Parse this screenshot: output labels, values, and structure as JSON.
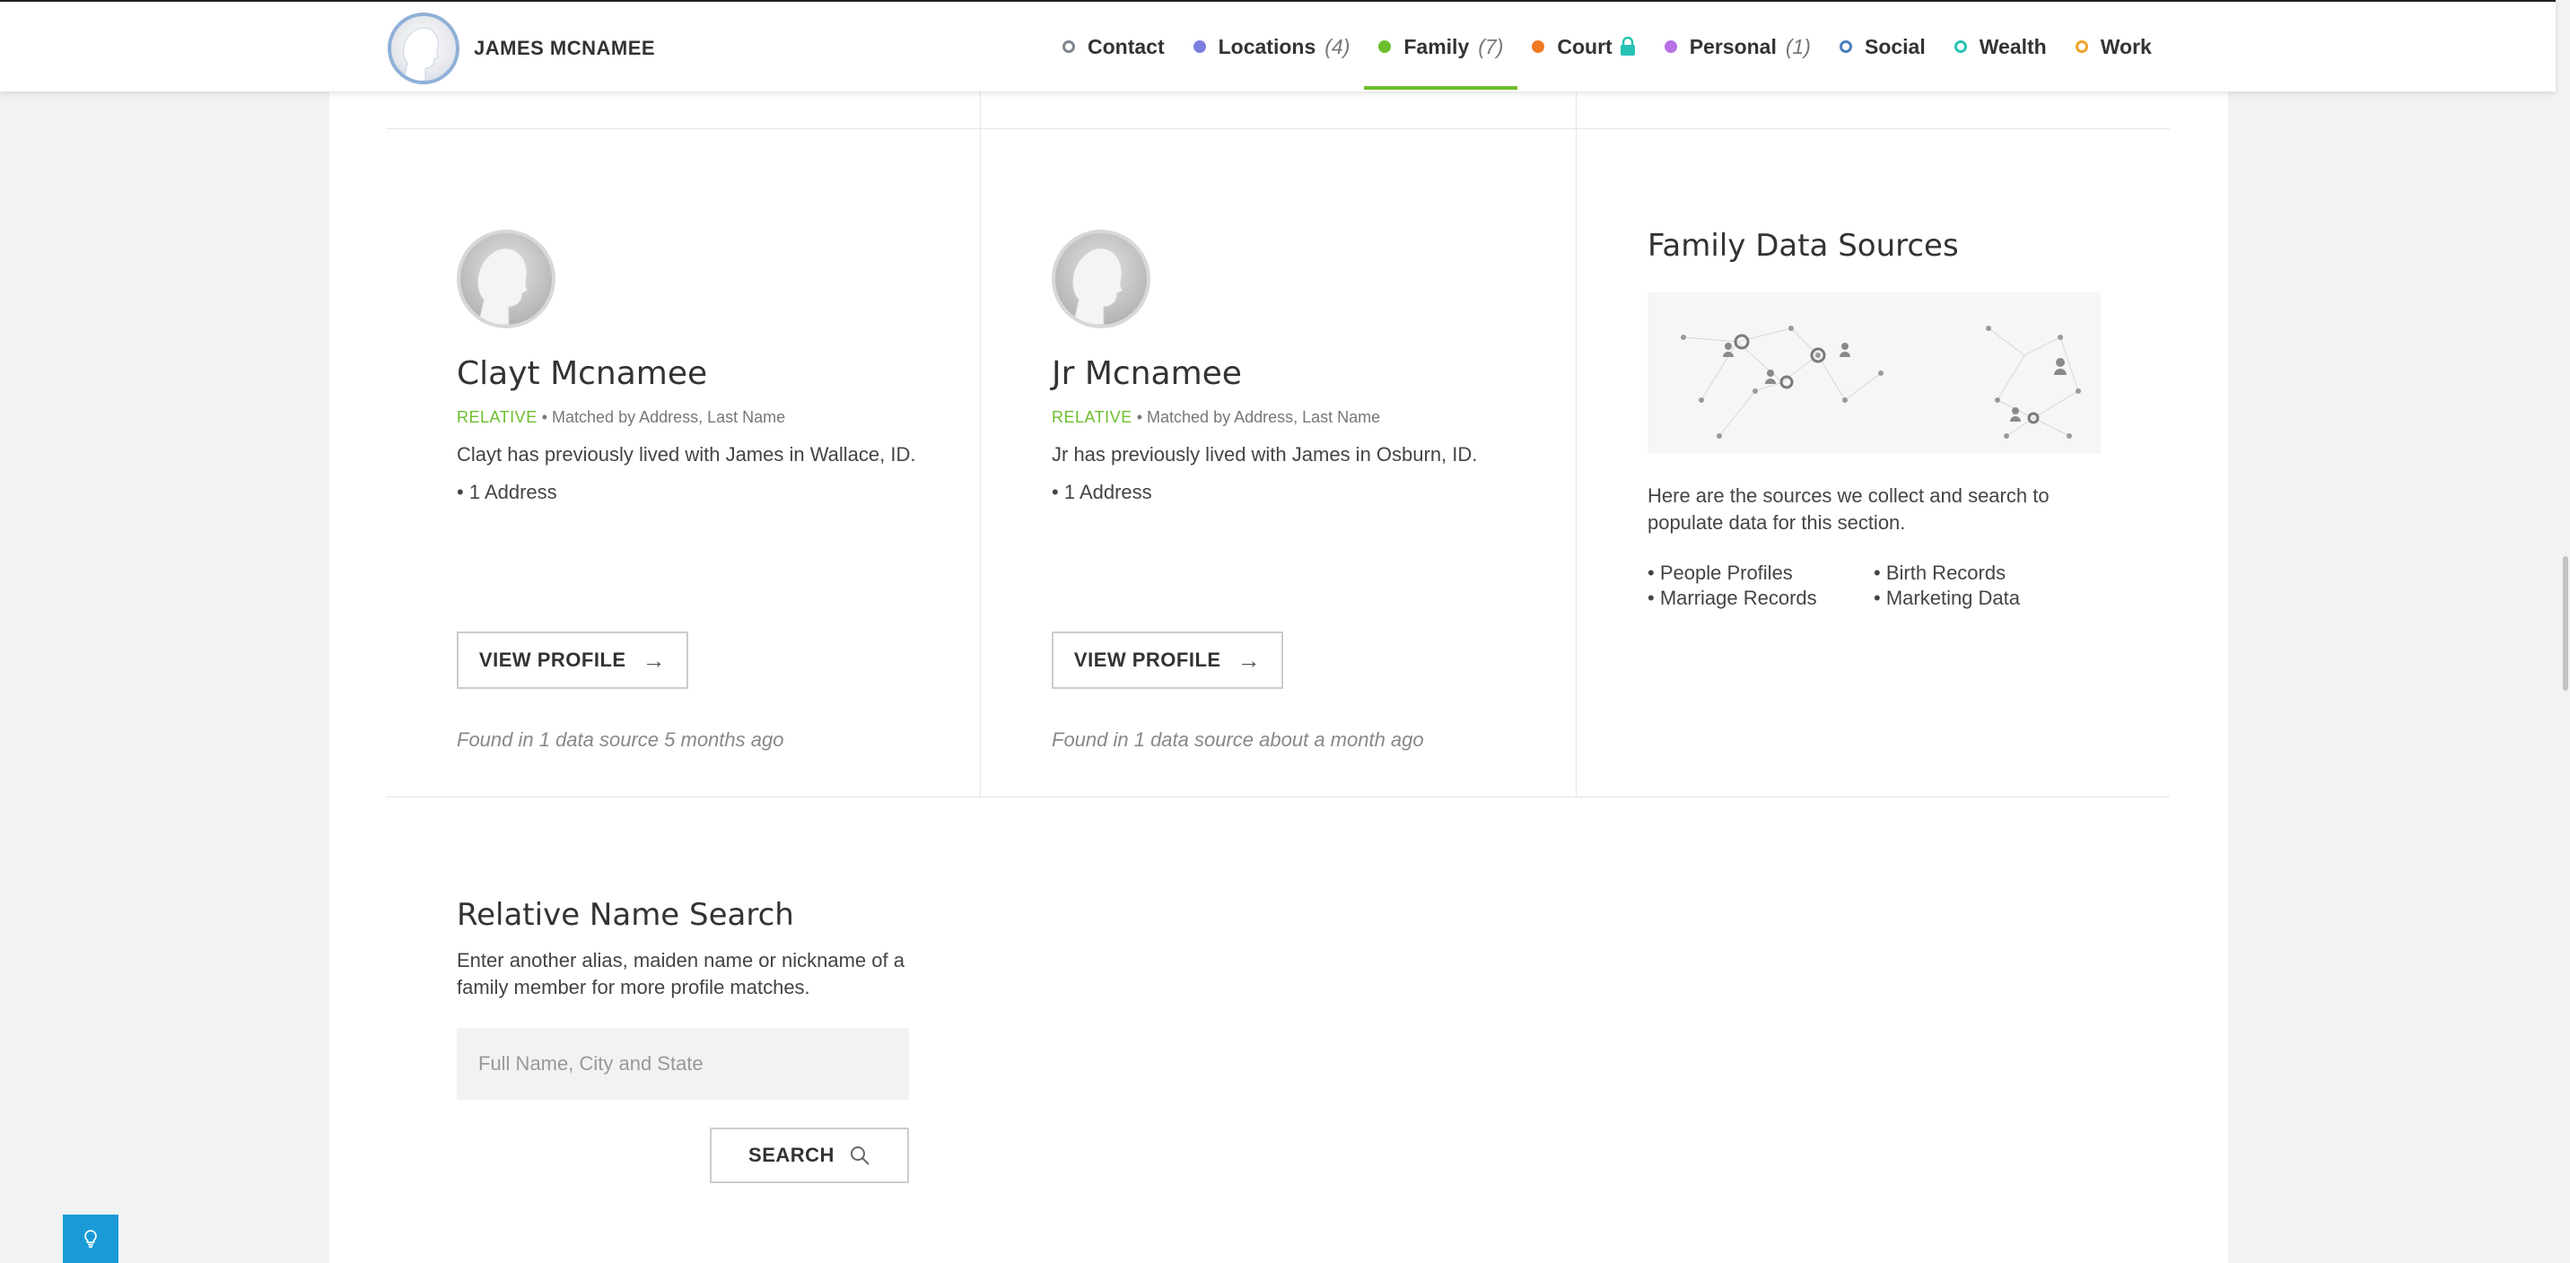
{
  "header": {
    "name": "JAMES MCNAMEE",
    "nav": [
      {
        "label": "Contact",
        "count": "",
        "color": "#7d8590",
        "style": "ring",
        "active": false
      },
      {
        "label": "Locations",
        "count": "(4)",
        "color": "#7b7fe0",
        "style": "fill",
        "active": false
      },
      {
        "label": "Family",
        "count": "(7)",
        "color": "#6cbe2c",
        "style": "fill",
        "active": true
      },
      {
        "label": "Court",
        "count": "",
        "color": "#f07a22",
        "style": "fill",
        "active": false,
        "lock": true
      },
      {
        "label": "Personal",
        "count": "(1)",
        "color": "#b672e6",
        "style": "fill",
        "active": false
      },
      {
        "label": "Social",
        "count": "",
        "color": "#4a7fbf",
        "style": "ring",
        "active": false
      },
      {
        "label": "Wealth",
        "count": "",
        "color": "#27c2b4",
        "style": "ring",
        "active": false
      },
      {
        "label": "Work",
        "count": "",
        "color": "#f0a22a",
        "style": "ring",
        "active": false
      }
    ],
    "lock_color": "#27c2b4"
  },
  "relatives": [
    {
      "name": "Clayt Mcnamee",
      "tag": "RELATIVE",
      "match": "Matched by Address, Last Name",
      "description": "Clayt has previously lived with James in Wallace, ID.",
      "bullet": "1 Address",
      "button": "VIEW PROFILE",
      "found": "Found in 1 data source 5 months ago"
    },
    {
      "name": "Jr Mcnamee",
      "tag": "RELATIVE",
      "match": "Matched by Address, Last Name",
      "description": "Jr has previously lived with James in Osburn, ID.",
      "bullet": "1 Address",
      "button": "VIEW PROFILE",
      "found": "Found in 1 data source about a month ago"
    }
  ],
  "data_sources": {
    "title": "Family Data Sources",
    "description": "Here are the sources we collect and search to populate data for this section.",
    "items": [
      "People Profiles",
      "Birth Records",
      "Marriage Records",
      "Marketing Data"
    ]
  },
  "search": {
    "title": "Relative Name Search",
    "subtitle": "Enter another alias, maiden name or nickname of a family member for more profile matches.",
    "placeholder": "Full Name, City and State",
    "button": "SEARCH"
  }
}
